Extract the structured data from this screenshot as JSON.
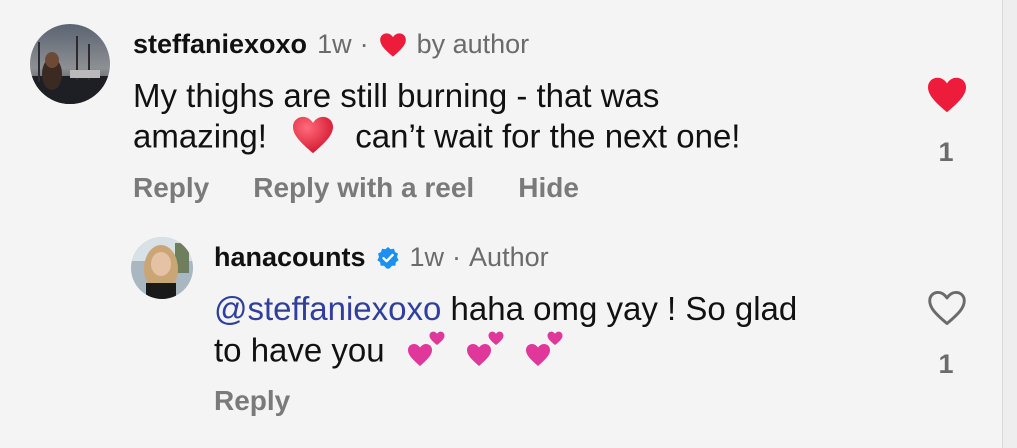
{
  "comments": [
    {
      "username": "steffaniexoxo",
      "time": "1w",
      "separator": "·",
      "liked_by": "by author",
      "text_line1": "My thighs are still burning - that was",
      "text_line2a": "amazing!",
      "text_line2b": "can’t wait for the next one!",
      "actions": [
        "Reply",
        "Reply with a reel",
        "Hide"
      ],
      "like_count": "1",
      "liked": true
    },
    {
      "username": "hanacounts",
      "time": "1w",
      "separator": "·",
      "role": "Author",
      "mention": "@steffaniexoxo",
      "text_line1_rest": " haha omg yay ! So glad",
      "text_line2": "to have you",
      "actions": [
        "Reply"
      ],
      "like_count": "1",
      "liked": false
    }
  ],
  "colors": {
    "heart_red": "#ed1c3a",
    "mention_blue": "#2f3f9e",
    "verified_blue": "#1d8ff0",
    "emoji_heart": "#e0243a",
    "emoji_pink": "#e0389a"
  },
  "icons": {
    "liked_heart": "heart-filled-icon",
    "unliked_heart": "heart-outline-icon",
    "verified": "verified-badge-icon"
  }
}
